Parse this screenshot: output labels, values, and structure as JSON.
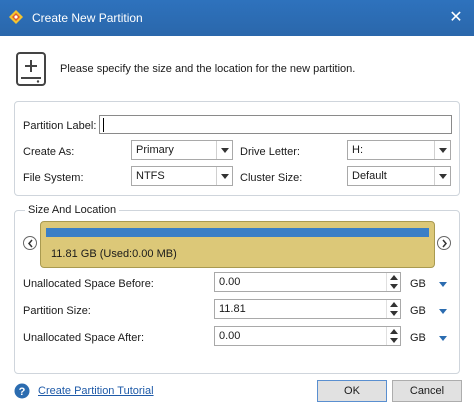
{
  "window": {
    "title": "Create New Partition",
    "close_glyph": "✕",
    "accent": "#2b6cb0"
  },
  "intro": {
    "icon": "add-disk-icon",
    "text": "Please specify the size and the location for the new partition."
  },
  "fields": {
    "partition_label": {
      "label": "Partition Label:",
      "value": ""
    },
    "create_as": {
      "label": "Create As:",
      "value": "Primary"
    },
    "drive_letter": {
      "label": "Drive Letter:",
      "value": "H:"
    },
    "file_system": {
      "label": "File System:",
      "value": "NTFS"
    },
    "cluster_size": {
      "label": "Cluster Size:",
      "value": "Default"
    }
  },
  "size_location": {
    "title": "Size And Location",
    "bar_text": "11.81 GB (Used:0.00 MB)",
    "bar_color": "#3a7fc6",
    "bar_bg": "#dcc878",
    "unallocated_before": {
      "label": "Unallocated Space Before:",
      "value": "0.00",
      "unit": "GB"
    },
    "partition_size": {
      "label": "Partition Size:",
      "value": "11.81",
      "unit": "GB"
    },
    "unallocated_after": {
      "label": "Unallocated Space After:",
      "value": "0.00",
      "unit": "GB"
    }
  },
  "footer": {
    "help_link": "Create Partition Tutorial",
    "ok": "OK",
    "cancel": "Cancel"
  }
}
